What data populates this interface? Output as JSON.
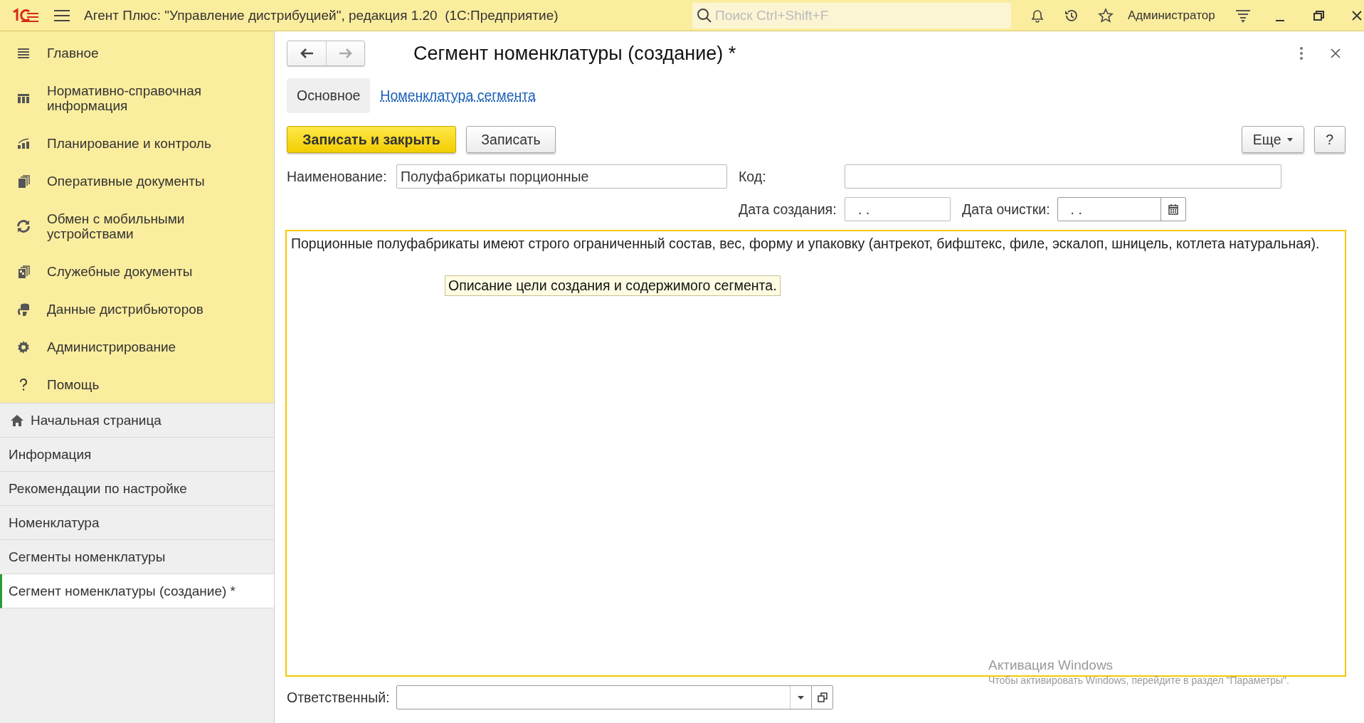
{
  "app": {
    "title": "Агент Плюс: \"Управление дистрибуцией\", редакция 1.20  (1С:Предприятие)",
    "search": {
      "placeholder": "Поиск Ctrl+Shift+F"
    },
    "user": "Администратор"
  },
  "sections": [
    {
      "label": "Главное",
      "kind": "menu"
    },
    {
      "label": "Нормативно-справочная информация",
      "kind": "catalog"
    },
    {
      "label": "Планирование и контроль",
      "kind": "chart"
    },
    {
      "label": "Оперативные документы",
      "kind": "docs"
    },
    {
      "label": "Обмен с мобильными устройствами",
      "kind": "sync"
    },
    {
      "label": "Служебные документы",
      "kind": "service"
    },
    {
      "label": "Данные дистрибьюторов",
      "kind": "data"
    },
    {
      "label": "Администрирование",
      "kind": "gear"
    },
    {
      "label": "Помощь",
      "kind": "help"
    }
  ],
  "open_pages": [
    {
      "label": "Начальная страница",
      "kind": "home",
      "selected": false
    },
    {
      "label": "Информация",
      "kind": "page",
      "selected": false
    },
    {
      "label": "Рекомендации по настройке",
      "kind": "page",
      "selected": false
    },
    {
      "label": "Номенклатура",
      "kind": "page",
      "selected": false
    },
    {
      "label": "Сегменты номенклатуры",
      "kind": "page",
      "selected": false
    },
    {
      "label": "Сегмент номенклатуры (создание) *",
      "kind": "page",
      "selected": true
    }
  ],
  "form": {
    "title": "Сегмент номенклатуры (создание) *",
    "nav": [
      {
        "kind": "back",
        "disabled": false
      },
      {
        "kind": "forward",
        "disabled": true
      }
    ],
    "tabs": [
      {
        "label": "Основное",
        "selected": true
      },
      {
        "label": "Номенклатура сегмента",
        "selected": false
      }
    ],
    "buttons": [
      {
        "label": "Записать и закрыть",
        "kind": "primary"
      },
      {
        "label": "Записать",
        "kind": "default"
      }
    ],
    "more_button": "Еще",
    "help_button": "?",
    "name": {
      "label": "Наименование:",
      "value": "Полуфабрикаты порционные"
    },
    "code": {
      "label": "Код:"
    },
    "created": {
      "label": "Дата создания:",
      "value": ". ."
    },
    "cleared": {
      "label": "Дата очистки:",
      "value": ". ."
    },
    "description": {
      "value": "Порционные полуфабрикаты имеют строго ограниченный состав, вес, форму и упаковку (антрекот, бифштекс, филе, эскалоп, шницель, котлета натуральная).",
      "tooltip": "Описание цели создания и содержимого сегмента."
    },
    "responsible": {
      "label": "Ответственный:"
    }
  },
  "activation_notice": {
    "title": "Активация Windows",
    "text": "Чтобы активировать Windows, перейдите в раздел \"Параметры\"."
  }
}
